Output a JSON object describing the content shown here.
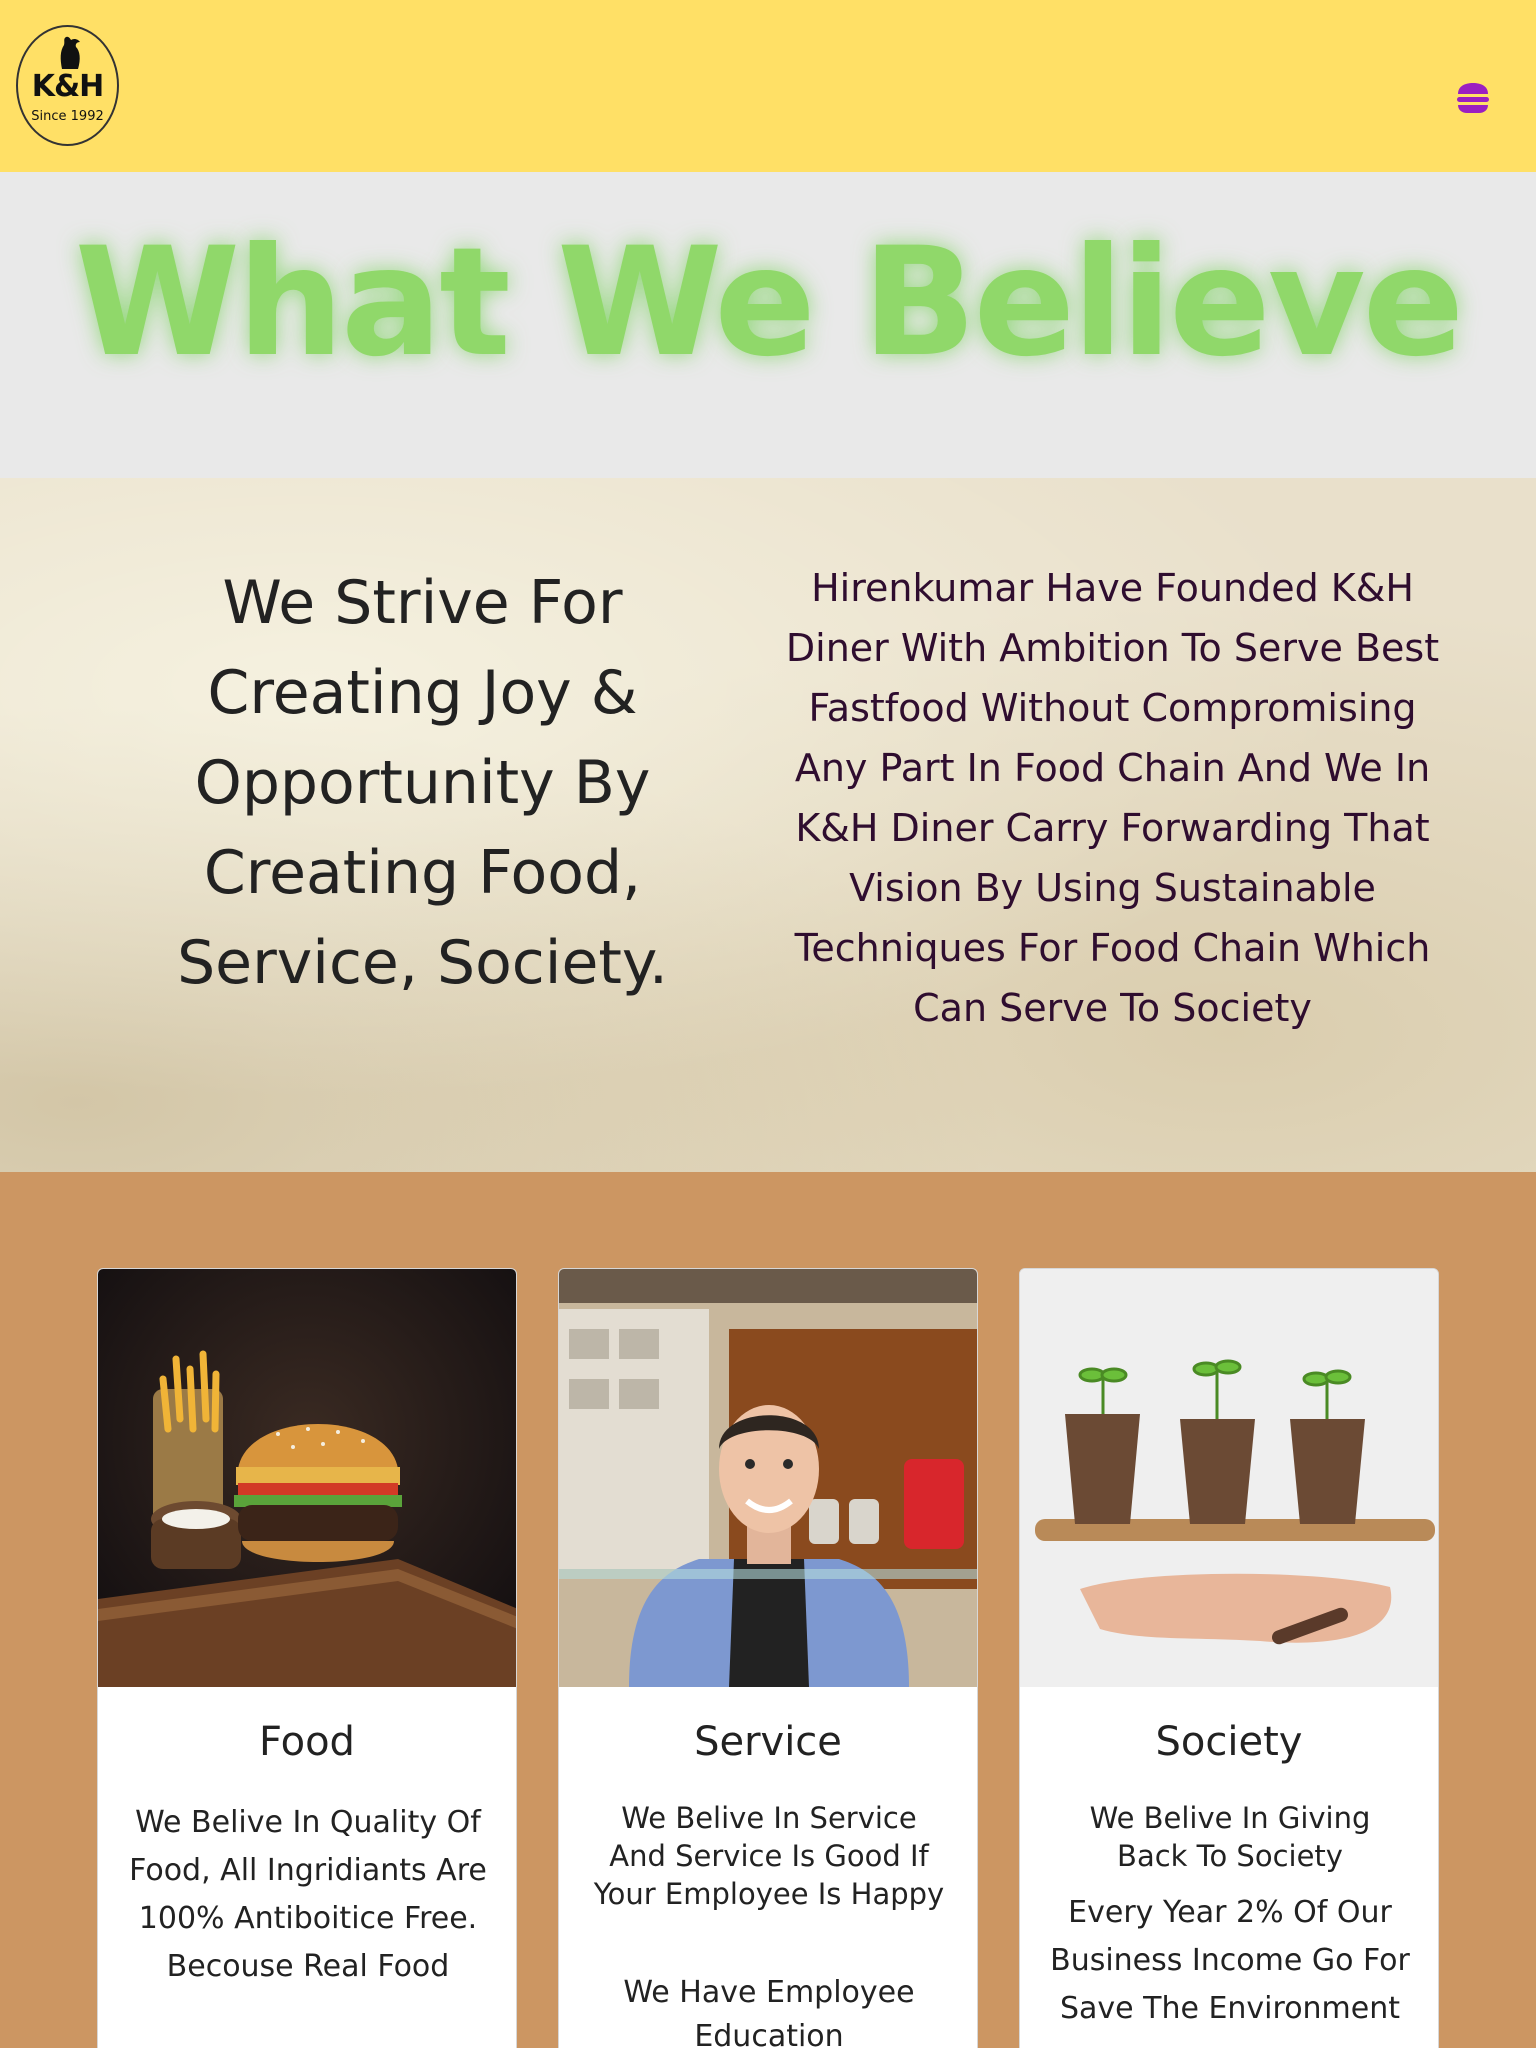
{
  "header": {
    "logo_mark": "K&H",
    "logo_since": "Since 1992",
    "menu_icon": "hamburger-icon",
    "menu_color": "#9b1fc1",
    "bg_color": "#ffe066"
  },
  "hero": {
    "title": "What We Believe",
    "title_color": "#90d86a"
  },
  "about": {
    "strive": "We Strive For Creating Joy & Opportunity By Creating Food, Service, Society.",
    "founded": "Hirenkumar Have Founded K&H Diner With Ambition To Serve Best Fastfood Without Compromising Any Part In Food Chain And We In K&H Diner Carry Forwarding That Vision By Using Sustainable Techniques For Food Chain Which Can Serve To Society"
  },
  "cards": [
    {
      "title": "Food",
      "image": "burger-and-fries-photo",
      "paragraphs": [
        "We Belive In Quality Of Food, All Ingridiants Are 100% Antiboitice Free. Becouse Real Food"
      ]
    },
    {
      "title": "Service",
      "image": "smiling-employee-photo",
      "paragraphs": [
        "We Belive In Service And Service Is Good If Your Employee Is Happy",
        "We Have Employee Education"
      ]
    },
    {
      "title": "Society",
      "image": "seedlings-in-hands-photo",
      "paragraphs": [
        "We Belive In Giving Back To Society",
        "Every Year 2% Of Our Business Income Go For Save The Environment"
      ]
    }
  ],
  "colors": {
    "section_bg": "#cc9662",
    "paper_bg": "#e9e0cb"
  }
}
